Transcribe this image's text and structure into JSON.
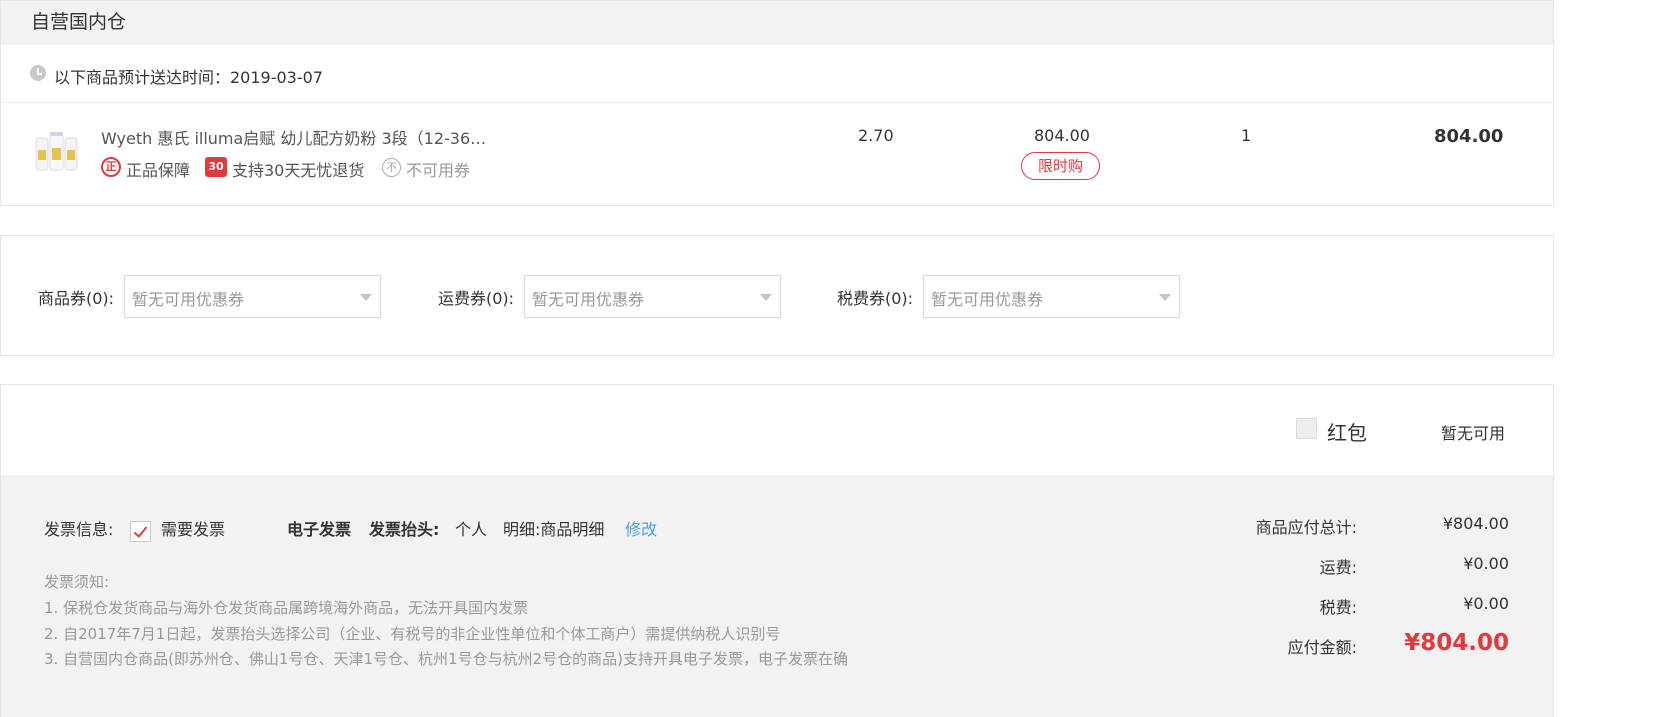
{
  "warehouse": {
    "title": "自营国内仓"
  },
  "delivery": {
    "text": "以下商品预计送达时间：2019-03-07"
  },
  "product": {
    "name": "Wyeth 惠氏 illuma启赋 幼儿配方奶粉 3段（12-36…",
    "badges": [
      {
        "icon": "正",
        "label": "正品保障"
      },
      {
        "icon": "30",
        "label": "支持30天无忧退货"
      },
      {
        "icon": "不",
        "label": "不可用券"
      }
    ],
    "tax_rate": "2.70",
    "unit_price": "804.00",
    "tag": "限时购",
    "quantity": "1",
    "subtotal": "804.00"
  },
  "coupons": [
    {
      "label": "商品券(0):",
      "placeholder": "暂无可用优惠券"
    },
    {
      "label": "运费券(0):",
      "placeholder": "暂无可用优惠券"
    },
    {
      "label": "税费券(0):",
      "placeholder": "暂无可用优惠券"
    }
  ],
  "red_packet": {
    "label": "红包",
    "status": "暂无可用"
  },
  "invoice": {
    "label": "发票信息:",
    "need_label": "需要发票",
    "need_checked": true,
    "type": "电子发票",
    "head_label": "发票抬头:",
    "head_value": "个人",
    "detail": "明细:商品明细",
    "edit": "修改",
    "notice_title": "发票须知:",
    "notices": [
      "1. 保税仓发货商品与海外仓发货商品属跨境海外商品，无法开具国内发票",
      "2. 自2017年7月1日起，发票抬头选择公司（企业、有税号的非企业性单位和个体工商户）需提供纳税人识别号",
      "3. 自营国内仓商品(即苏州仓、佛山1号仓、天津1号仓、杭州1号仓与杭州2号仓的商品)支持开具电子发票，电子发票在确"
    ]
  },
  "summary": {
    "goods_total_label": "商品应付总计:",
    "goods_total": "¥804.00",
    "shipping_label": "运费:",
    "shipping": "¥0.00",
    "tax_label": "税费:",
    "tax": "¥0.00",
    "payable_label": "应付金额:",
    "payable": "¥804.00"
  },
  "colors": {
    "accent_red": "#e4393c",
    "link_blue": "#4a9fe0",
    "gray_bg": "#f2f2f2"
  }
}
